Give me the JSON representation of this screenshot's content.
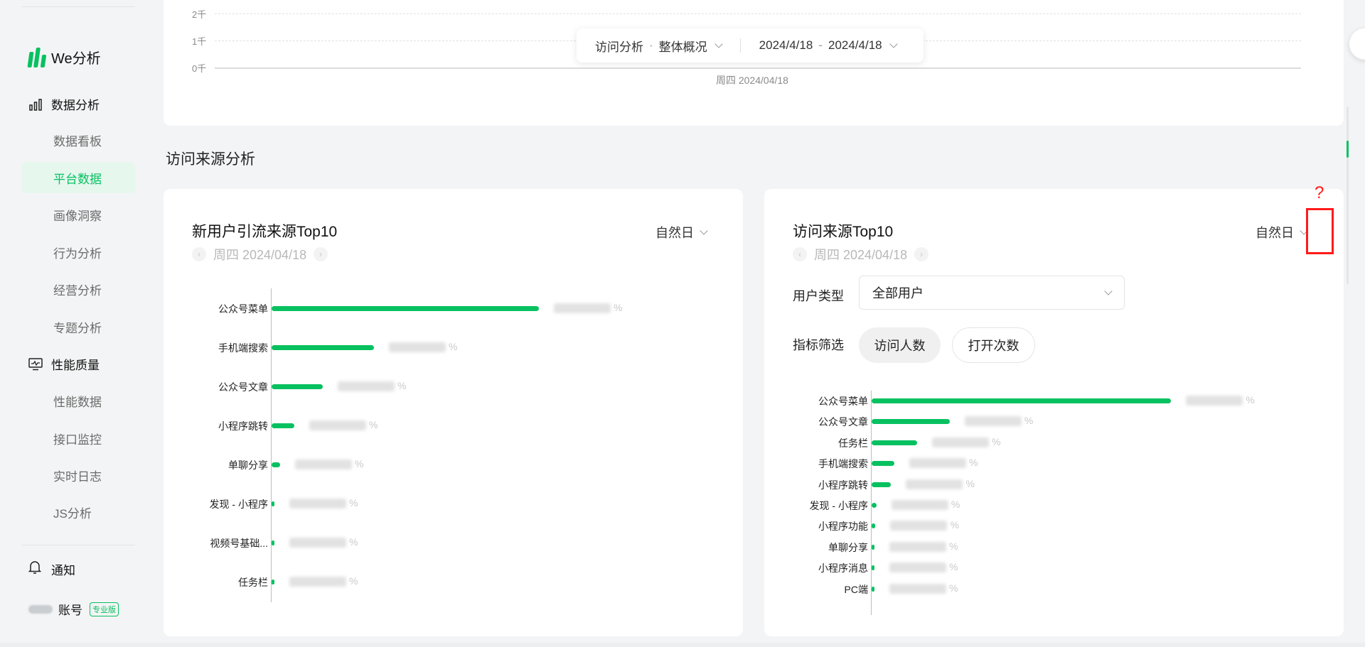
{
  "sidebar": {
    "logo_text": "We分析",
    "group_data": "数据分析",
    "items_data": [
      "数据看板",
      "平台数据",
      "画像洞察",
      "行为分析",
      "经营分析",
      "专题分析"
    ],
    "active_item": "平台数据",
    "group_perf": "性能质量",
    "items_perf": [
      "性能数据",
      "接口监控",
      "实时日志",
      "JS分析"
    ],
    "notify": "通知",
    "account": "账号",
    "account_badge": "专业版"
  },
  "top_chart": {
    "y_ticks": [
      "2千",
      "1千",
      "0千"
    ],
    "x_date": "周四 2024/04/18"
  },
  "filter_bar": {
    "analysis": "访问分析",
    "dot": "·",
    "scope": "整体概况",
    "date_start": "2024/4/18",
    "date_end": "2024/4/18"
  },
  "section_title": "访问来源分析",
  "left_card": {
    "title": "新用户引流来源Top10",
    "date": "周四 2024/04/18",
    "period": "自然日",
    "pct_suffix": "%",
    "bars": [
      {
        "label": "公众号菜单",
        "value": 0.94
      },
      {
        "label": "手机端搜索",
        "value": 0.36
      },
      {
        "label": "公众号文章",
        "value": 0.18
      },
      {
        "label": "小程序跳转",
        "value": 0.08
      },
      {
        "label": "单聊分享",
        "value": 0.03
      },
      {
        "label": "发现 - 小程序",
        "value": 0.01
      },
      {
        "label": "视频号基础...",
        "value": 0.01
      },
      {
        "label": "任务栏",
        "value": 0.01
      }
    ]
  },
  "right_card": {
    "title": "访问来源Top10",
    "date": "周四 2024/04/18",
    "period": "自然日",
    "user_type_label": "用户类型",
    "user_type_value": "全部用户",
    "metric_label": "指标筛选",
    "metric_options": [
      "访问人数",
      "打开次数"
    ],
    "selected_metric": "访问人数",
    "pct_suffix": "%",
    "bars": [
      {
        "label": "公众号菜单",
        "value": 0.92
      },
      {
        "label": "公众号文章",
        "value": 0.24
      },
      {
        "label": "任务栏",
        "value": 0.14
      },
      {
        "label": "手机端搜索",
        "value": 0.07
      },
      {
        "label": "小程序跳转",
        "value": 0.06
      },
      {
        "label": "发现 - 小程序",
        "value": 0.015
      },
      {
        "label": "小程序功能",
        "value": 0.012
      },
      {
        "label": "单聊分享",
        "value": 0.008
      },
      {
        "label": "小程序消息",
        "value": 0.006
      },
      {
        "label": "PC端",
        "value": 0.004
      }
    ]
  },
  "annotation": {
    "mark": "?",
    "color": "#ff1a1a"
  },
  "colors": {
    "accent": "#07c160",
    "active_bg": "#e6f7ee"
  }
}
